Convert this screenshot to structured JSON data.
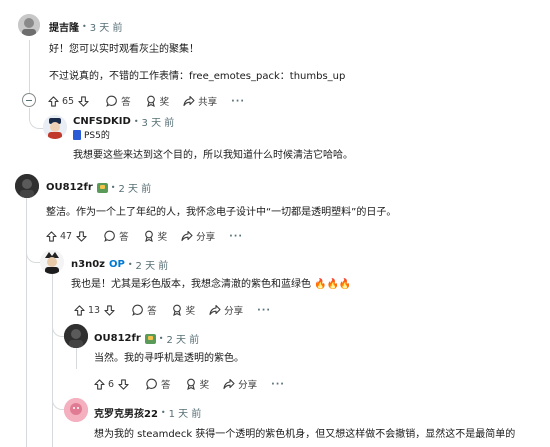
{
  "comments": [
    {
      "username": "提吉隆",
      "time": "3 天 前",
      "lines": [
        "好！您可以实时观看灰尘的聚集！",
        "不过说真的，不错的工作表情：free_emotes_pack：thumbs_up"
      ],
      "votes": "65",
      "reply_label": "答",
      "award_label": "奖",
      "share_label": "共享"
    },
    {
      "username": "CNFSDKID",
      "time": "3 天 前",
      "flair": "PS5的",
      "lines": [
        "我想要这些来达到这个目的，所以我知道什么时候清洁它哈哈。"
      ]
    },
    {
      "username": "OU812fr",
      "time": "2 天 前",
      "lines": [
        "整洁。作为一个上了年纪的人，我怀念电子设计中“一切都是透明塑料”的日子。"
      ],
      "votes": "47",
      "reply_label": "答",
      "award_label": "奖",
      "share_label": "分享"
    },
    {
      "username": "n3n0z",
      "op": "OP",
      "time": "2 天 前",
      "lines": [
        "我也是！尤其是彩色版本，我想念清澈的紫色和蓝绿色"
      ],
      "emoji": "🔥🔥🔥",
      "votes": "13",
      "reply_label": "答",
      "award_label": "奖",
      "share_label": "分享"
    },
    {
      "username": "OU812fr",
      "time": "2 天 前",
      "lines": [
        "当然。我的寻呼机是透明的紫色。"
      ],
      "votes": "6",
      "reply_label": "答",
      "award_label": "奖",
      "share_label": "分享"
    },
    {
      "username": "克罗克男孩22",
      "time": "1 天 前",
      "lines": [
        "想为我的 steamdeck 获得一个透明的紫色机身，但又想这样做不会撤销，显然这不是最简单的"
      ]
    }
  ],
  "more_label": "···",
  "colors": {
    "accent": "#0079d3",
    "fire": "#e8590c"
  }
}
